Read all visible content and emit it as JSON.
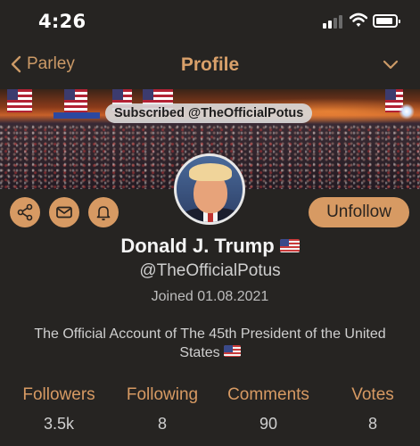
{
  "status_bar": {
    "time": "4:26"
  },
  "nav": {
    "back_label": "Parley",
    "title": "Profile"
  },
  "banner": {
    "subscribed_text": "Subscribed @TheOfficialPotus"
  },
  "actions": {
    "unfollow_label": "Unfollow"
  },
  "profile": {
    "name": "Donald J. Trump",
    "handle": "@TheOfficialPotus",
    "joined": "Joined 01.08.2021",
    "bio": "The Official Account of The 45th President of the United States"
  },
  "stats": [
    {
      "label": "Followers",
      "value": "3.5k"
    },
    {
      "label": "Following",
      "value": "8"
    },
    {
      "label": "Comments",
      "value": "90"
    },
    {
      "label": "Votes",
      "value": "8"
    }
  ],
  "colors": {
    "accent": "#d79a63",
    "background": "#262422"
  },
  "icons": [
    "signal-icon",
    "wifi-icon",
    "battery-icon",
    "chevron-left-icon",
    "chevron-down-icon",
    "share-icon",
    "mail-icon",
    "bell-icon",
    "us-flag-icon"
  ]
}
